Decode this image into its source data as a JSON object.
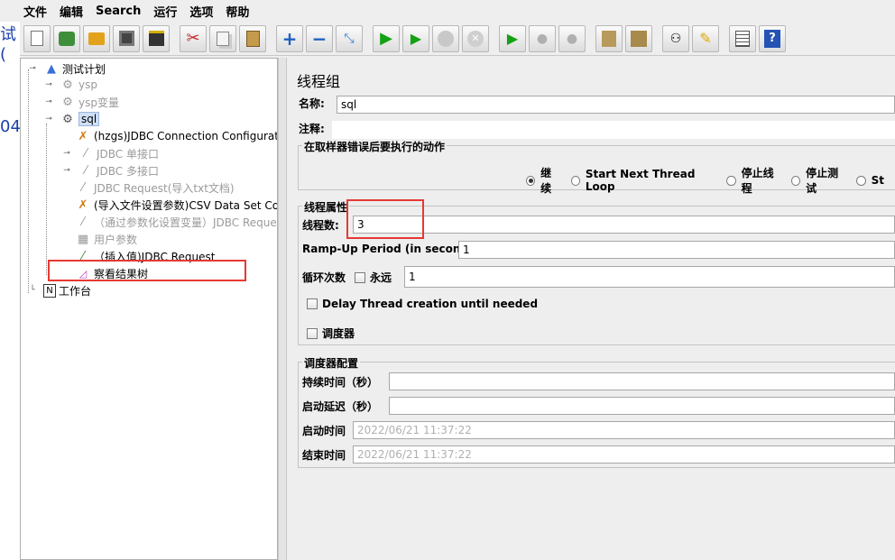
{
  "menu": [
    "文件",
    "编辑",
    "Search",
    "运行",
    "选项",
    "帮助"
  ],
  "left_strip": {
    "a": "试(",
    "b": "04"
  },
  "toolbar_icons": [
    "new-icon",
    "templates-icon",
    "open-icon",
    "save-icon",
    "save-as-icon",
    "cut-icon",
    "copy-icon",
    "paste-icon",
    "expand-icon",
    "collapse-icon",
    "toggle-icon",
    "start-icon",
    "start-no-pause-icon",
    "stop-icon",
    "shutdown-icon",
    "remote-start-icon",
    "remote-stop-icon",
    "remote-shutdown-icon",
    "clear-icon",
    "clear-all-icon",
    "search-icon",
    "reset-search-icon",
    "function-helper-icon",
    "help-icon"
  ],
  "tree": {
    "root": "测试计划",
    "items": [
      {
        "label": "ysp",
        "dim": true
      },
      {
        "label": "ysp变量",
        "dim": true
      },
      {
        "label": "sql",
        "selected": true
      },
      {
        "label": "(hzgs)JDBC Connection Configuratio",
        "dim": false
      },
      {
        "label": "JDBC 单接口",
        "dim": true
      },
      {
        "label": "JDBC 多接口",
        "dim": true
      },
      {
        "label": "JDBC Request(导入txt文档)",
        "dim": true
      },
      {
        "label": "(导入文件设置参数)CSV Data Set Cor",
        "dim": false
      },
      {
        "label": "（通过参数化设置变量）JDBC Reque",
        "dim": true
      },
      {
        "label": "用户参数",
        "dim": true
      },
      {
        "label": "（插入值)JDBC Request",
        "dim": false
      },
      {
        "label": "察看结果树",
        "dim": false
      }
    ],
    "workbench": "工作台"
  },
  "panel": {
    "title": "线程组",
    "name_label": "名称:",
    "name_value": "sql",
    "comment_label": "注释:",
    "error_group": "在取样器错误后要执行的动作",
    "error_options": [
      {
        "label": "继续",
        "checked": true
      },
      {
        "label": "Start Next Thread Loop",
        "checked": false
      },
      {
        "label": "停止线程",
        "checked": false
      },
      {
        "label": "停止测试",
        "checked": false
      },
      {
        "label": "St",
        "checked": false
      }
    ],
    "thread_group": "线程属性",
    "threads_label": "线程数:",
    "threads_value": "3",
    "rampup_label": "Ramp-Up Period (in seconds):",
    "rampup_value": "1",
    "loop_label": "循环次数",
    "forever_label": "永远",
    "loop_value": "1",
    "delay_label": "Delay Thread creation until needed",
    "scheduler_label": "调度器",
    "scheduler_group": "调度器配置",
    "duration_label": "持续时间（秒）",
    "startup_delay_label": "启动延迟（秒）",
    "start_time_label": "启动时间",
    "start_time_value": "2022/06/21 11:37:22",
    "end_time_label": "结束时间",
    "end_time_value": "2022/06/21 11:37:22"
  }
}
